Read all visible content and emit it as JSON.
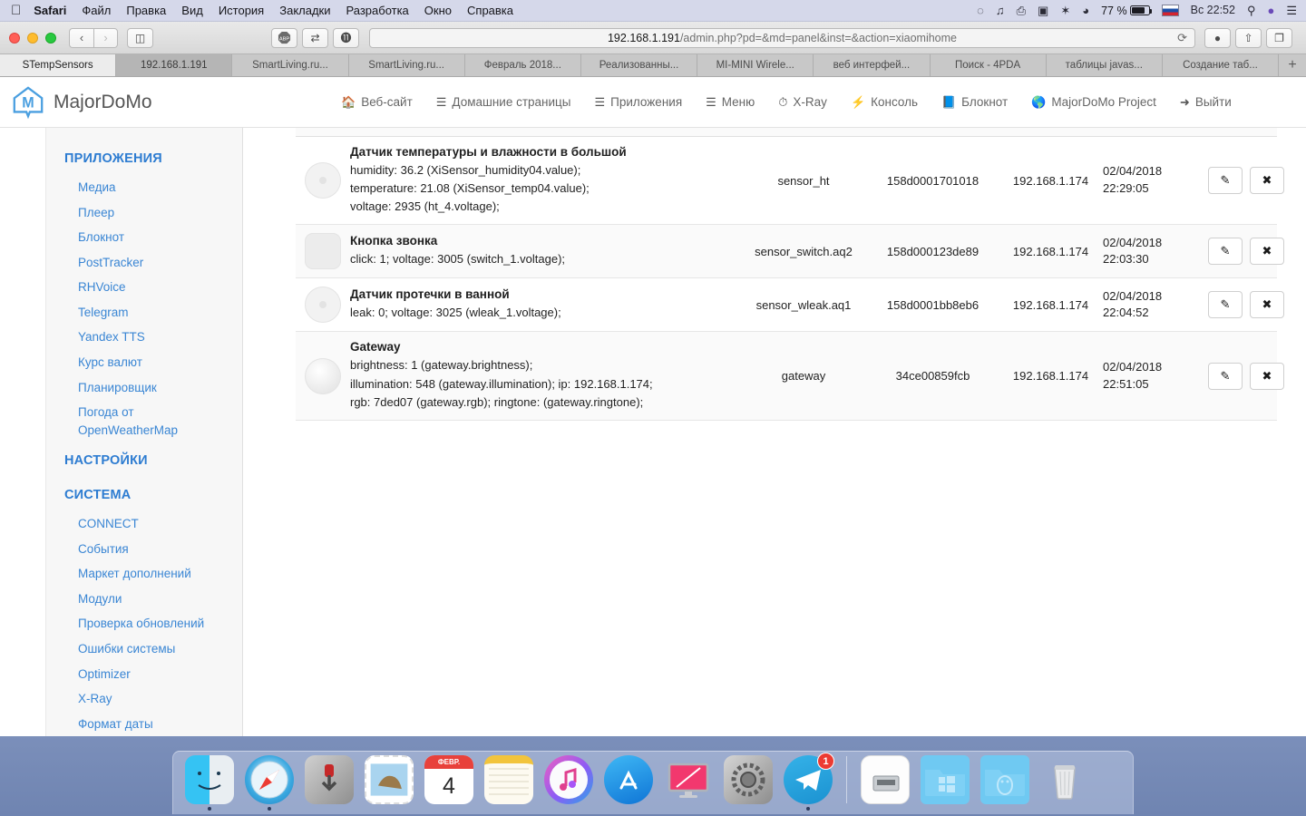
{
  "menubar": {
    "apple_icon": "apple-icon",
    "items": [
      {
        "label": "Safari",
        "bold": true
      },
      {
        "label": "Файл",
        "bold": false
      },
      {
        "label": "Правка",
        "bold": false
      },
      {
        "label": "Вид",
        "bold": false
      },
      {
        "label": "История",
        "bold": false
      },
      {
        "label": "Закладки",
        "bold": false
      },
      {
        "label": "Разработка",
        "bold": false
      },
      {
        "label": "Окно",
        "bold": false
      },
      {
        "label": "Справка",
        "bold": false
      }
    ],
    "status": {
      "creative_cloud_icon": "creative-cloud-icon",
      "soundflower_icon": "soundflower-icon",
      "keyboard_icon": "keyboard-viewer-icon",
      "airplay_icon": "airplay-icon",
      "bluetooth_icon": "bluetooth-icon",
      "wifi_icon": "wifi-icon",
      "battery_percent": "77 %",
      "input_flag": "ru-flag-icon",
      "clock": "Вс 22:52",
      "search_icon": "spotlight-search-icon",
      "siri_icon": "siri-icon",
      "notification_icon": "notification-center-icon"
    }
  },
  "browser": {
    "toolbar": {
      "back_icon": "back-arrow-icon",
      "forward_icon": "forward-arrow-icon",
      "sidebar_icon": "sidebar-toggle-icon",
      "adblock_icon": "adblock-plus-icon",
      "sync_icon": "sync-tabs-icon",
      "ghostery_icon": "ghostery-icon",
      "download_icon": "downloads-icon",
      "share_icon": "share-icon",
      "tabs_icon": "show-all-tabs-icon",
      "reload_icon": "reload-icon"
    },
    "url": {
      "host": "192.168.1.191",
      "path": "/admin.php?pd=&md=panel&inst=&action=xiaomihome",
      "full": "192.168.1.191/admin.php?pd=&md=panel&inst=&action=xiaomihome"
    },
    "tabs": [
      {
        "label": "STempSensors",
        "state": "active"
      },
      {
        "label": "192.168.1.191",
        "state": "current"
      },
      {
        "label": "SmartLiving.ru...",
        "state": "normal"
      },
      {
        "label": "SmartLiving.ru...",
        "state": "normal"
      },
      {
        "label": "Февраль 2018...",
        "state": "normal"
      },
      {
        "label": "Реализованны...",
        "state": "normal"
      },
      {
        "label": "MI-MINI Wirele...",
        "state": "normal"
      },
      {
        "label": "веб интерфей...",
        "state": "normal"
      },
      {
        "label": "Поиск - 4PDA",
        "state": "normal"
      },
      {
        "label": "таблицы javas...",
        "state": "normal"
      },
      {
        "label": "Создание таб...",
        "state": "normal"
      }
    ],
    "new_tab_label": "+"
  },
  "app": {
    "brand": {
      "name": "MajorDoMo",
      "logo_letter": "M",
      "accent": "#4a9fe0"
    },
    "nav": [
      {
        "label": "Веб-сайт",
        "icon": "home-icon"
      },
      {
        "label": "Домашние страницы",
        "icon": "list-icon"
      },
      {
        "label": "Приложения",
        "icon": "list-icon"
      },
      {
        "label": "Меню",
        "icon": "list-icon"
      },
      {
        "label": "X-Ray",
        "icon": "clock-icon"
      },
      {
        "label": "Консоль",
        "icon": "bolt-icon"
      },
      {
        "label": "Блокнот",
        "icon": "book-icon"
      },
      {
        "label": "MajorDoMo Project",
        "icon": "globe-icon"
      },
      {
        "label": "Выйти",
        "icon": "logout-icon"
      }
    ]
  },
  "sidebar": {
    "groups": [
      {
        "title": "ПРИЛОЖЕНИЯ",
        "items": [
          "Медиа",
          "Плеер",
          "Блокнот",
          "PostTracker",
          "RHVoice",
          "Telegram",
          "Yandex TTS",
          "Курс валют",
          "Планировщик",
          "Погода от OpenWeatherMap"
        ]
      },
      {
        "title": "НАСТРОЙКИ",
        "items": []
      },
      {
        "title": "СИСТЕМА",
        "items": [
          "CONNECT",
          "События",
          "Маркет дополнений",
          "Модули",
          "Проверка обновлений",
          "Ошибки системы",
          "Optimizer",
          "X-Ray",
          "Формат даты"
        ]
      }
    ]
  },
  "devices": {
    "edit_icon": "pencil-icon",
    "delete_icon": "close-x-icon",
    "rows": [
      {
        "title": "Датчик температуры и влажности в большой",
        "lines": [
          "humidity: 36.2 (XiSensor_humidity04.value);",
          "temperature: 21.08 (XiSensor_temp04.value);",
          "voltage: 2935 (ht_4.voltage);"
        ],
        "model": "sensor_ht",
        "sid": "158d0001701018",
        "ip": "192.168.1.174",
        "date": "02/04/2018",
        "time": "22:29:05",
        "icon_shape": "round"
      },
      {
        "title": "Кнопка звонка",
        "lines": [
          "click: 1; voltage: 3005 (switch_1.voltage);"
        ],
        "model": "sensor_switch.aq2",
        "sid": "158d000123de89",
        "ip": "192.168.1.174",
        "date": "02/04/2018",
        "time": "22:03:30",
        "icon_shape": "square"
      },
      {
        "title": "Датчик протечки в ванной",
        "lines": [
          "leak: 0; voltage: 3025 (wleak_1.voltage);"
        ],
        "model": "sensor_wleak.aq1",
        "sid": "158d0001bb8eb6",
        "ip": "192.168.1.174",
        "date": "02/04/2018",
        "time": "22:04:52",
        "icon_shape": "round"
      },
      {
        "title": "Gateway",
        "lines": [
          "brightness: 1 (gateway.brightness);",
          "illumination: 548 (gateway.illumination); ip: 192.168.1.174;",
          "rgb: 7ded07 (gateway.rgb); ringtone: (gateway.ringtone);"
        ],
        "model": "gateway",
        "sid": "34ce00859fcb",
        "ip": "192.168.1.174",
        "date": "02/04/2018",
        "time": "22:51:05",
        "icon_shape": "gateway"
      }
    ]
  },
  "dock": {
    "items": [
      {
        "name": "finder-icon",
        "running": true
      },
      {
        "name": "safari-icon",
        "running": true
      },
      {
        "name": "transmission-icon",
        "running": false
      },
      {
        "name": "mail-icon",
        "running": false
      },
      {
        "name": "calendar-icon",
        "running": false,
        "month": "ФЕВР.",
        "day": "4"
      },
      {
        "name": "notes-icon",
        "running": false
      },
      {
        "name": "itunes-icon",
        "running": false
      },
      {
        "name": "app-store-icon",
        "running": false
      },
      {
        "name": "screen-sharing-icon",
        "running": false
      },
      {
        "name": "system-preferences-icon",
        "running": false
      },
      {
        "name": "telegram-icon",
        "running": true,
        "badge": "1"
      },
      {
        "name": "separator",
        "running": false
      },
      {
        "name": "disk-image-icon",
        "running": false
      },
      {
        "name": "windows-folder-icon",
        "running": false
      },
      {
        "name": "linux-folder-icon",
        "running": false
      },
      {
        "name": "trash-icon",
        "running": false
      }
    ]
  }
}
